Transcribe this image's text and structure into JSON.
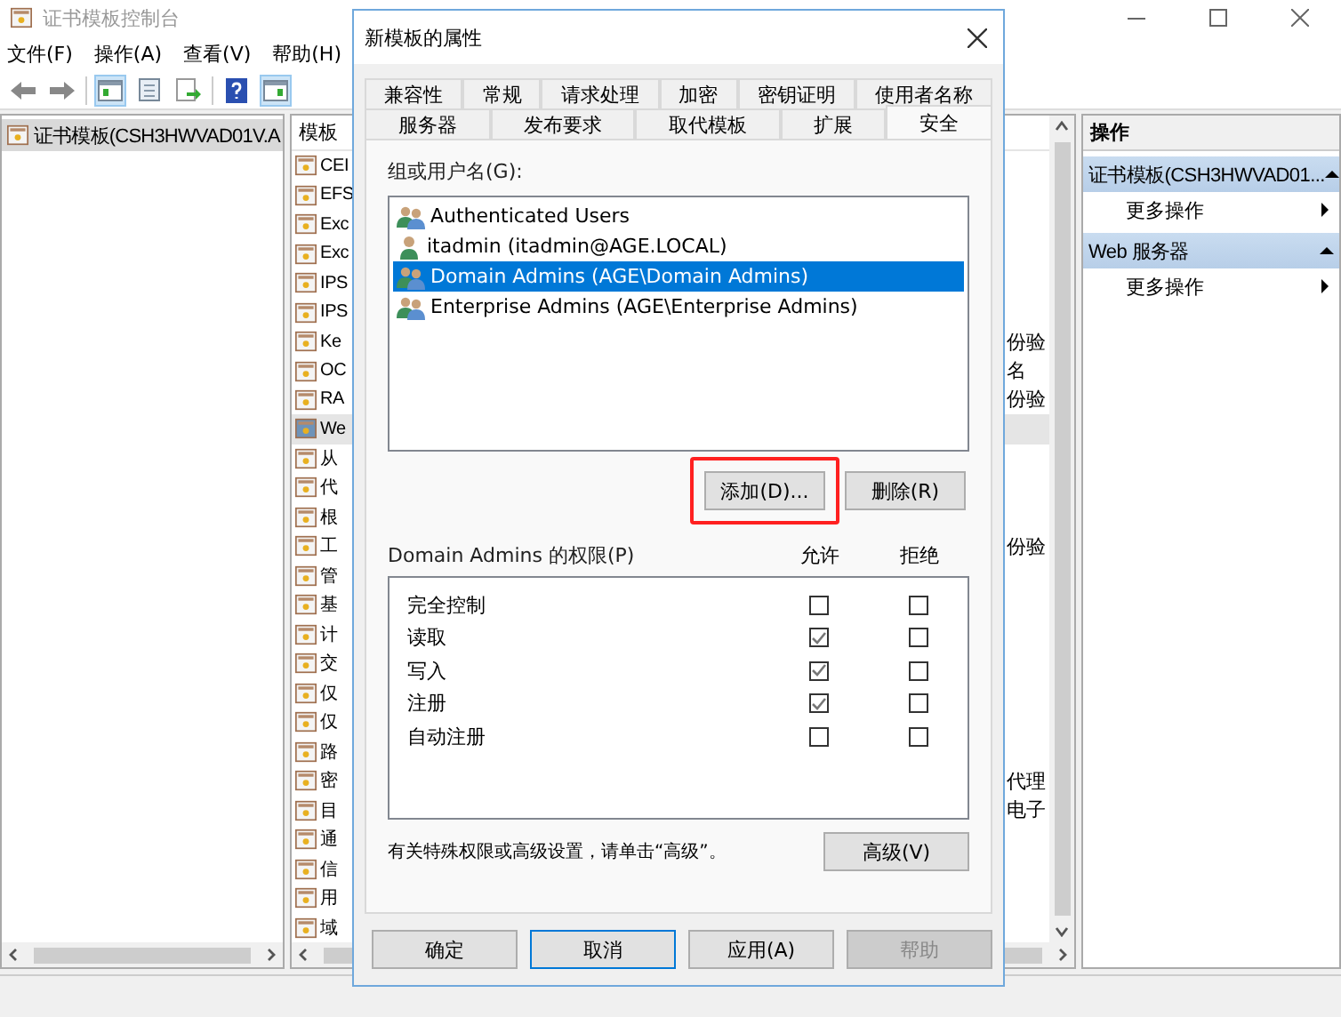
{
  "window": {
    "title": "证书模板控制台"
  },
  "menu": [
    "文件(F)",
    "操作(A)",
    "查看(V)",
    "帮助(H)"
  ],
  "tree": {
    "items": [
      {
        "label": "证书模板(CSH3HWVAD01V.A",
        "selected": true
      }
    ]
  },
  "templates": {
    "header": "模板",
    "rows": [
      {
        "name": "CEI",
        "selected": false
      },
      {
        "name": "EFS",
        "selected": false
      },
      {
        "name": "Exc",
        "selected": false
      },
      {
        "name": "Exc",
        "selected": false
      },
      {
        "name": "IPS",
        "selected": false
      },
      {
        "name": "IPS",
        "selected": false
      },
      {
        "name": "Ke",
        "detail": "份验",
        "selected": false
      },
      {
        "name": "OC",
        "detail": "名",
        "selected": false
      },
      {
        "name": "RA",
        "detail": "份验",
        "selected": false
      },
      {
        "name": "We",
        "selected": true
      },
      {
        "name": "从",
        "selected": false
      },
      {
        "name": "代",
        "selected": false
      },
      {
        "name": "根",
        "selected": false
      },
      {
        "name": "工",
        "detail": "份验",
        "selected": false
      },
      {
        "name": "管",
        "selected": false
      },
      {
        "name": "基",
        "selected": false
      },
      {
        "name": "计",
        "selected": false
      },
      {
        "name": "交",
        "selected": false
      },
      {
        "name": "仅",
        "selected": false
      },
      {
        "name": "仅",
        "selected": false
      },
      {
        "name": "路",
        "selected": false
      },
      {
        "name": "密",
        "detail": "代理",
        "selected": false
      },
      {
        "name": "目",
        "detail": "电子",
        "selected": false
      },
      {
        "name": "通",
        "selected": false
      },
      {
        "name": "信",
        "selected": false
      },
      {
        "name": "用",
        "selected": false
      },
      {
        "name": "域",
        "selected": false
      }
    ]
  },
  "actions": {
    "title": "操作",
    "sections": [
      {
        "title": "证书模板(CSH3HWVAD01...",
        "items": [
          "更多操作"
        ]
      },
      {
        "title": "Web 服务器",
        "items": [
          "更多操作"
        ]
      }
    ]
  },
  "dialog": {
    "title": "新模板的属性",
    "tab_rows": [
      [
        {
          "label": "兼容性",
          "selected": false
        },
        {
          "label": "常规",
          "selected": false
        },
        {
          "label": "请求处理",
          "selected": false
        },
        {
          "label": "加密",
          "selected": false
        },
        {
          "label": "密钥证明",
          "selected": false
        },
        {
          "label": "使用者名称",
          "selected": false
        }
      ],
      [
        {
          "label": "服务器",
          "selected": false
        },
        {
          "label": "发布要求",
          "selected": false
        },
        {
          "label": "取代模板",
          "selected": false
        },
        {
          "label": "扩展",
          "selected": false
        },
        {
          "label": "安全",
          "selected": true
        }
      ]
    ],
    "groups_label": "组或用户名(G):",
    "principals": [
      {
        "name": "Authenticated Users",
        "kind": "group",
        "selected": false
      },
      {
        "name": "itadmin (itadmin@AGE.LOCAL)",
        "kind": "user",
        "selected": false
      },
      {
        "name": "Domain Admins (AGE\\Domain Admins)",
        "kind": "group",
        "selected": true
      },
      {
        "name": "Enterprise Admins (AGE\\Enterprise Admins)",
        "kind": "group",
        "selected": false
      }
    ],
    "principal_buttons": [
      {
        "label": "添加(D)...",
        "highlighted": true
      },
      {
        "label": "删除(R)",
        "highlighted": false
      }
    ],
    "permissions": {
      "label": "Domain Admins 的权限(P)",
      "columns": [
        "允许",
        "拒绝"
      ],
      "rows": [
        {
          "name": "完全控制",
          "allow": false,
          "deny": false
        },
        {
          "name": "读取",
          "allow": true,
          "deny": false
        },
        {
          "name": "写入",
          "allow": true,
          "deny": false
        },
        {
          "name": "注册",
          "allow": true,
          "deny": false
        },
        {
          "name": "自动注册",
          "allow": false,
          "deny": false
        }
      ]
    },
    "advanced_note": "有关特殊权限或高级设置，请单击“高级”。",
    "advanced_button": "高级(V)",
    "buttons": [
      {
        "label": "确定",
        "focused": false,
        "disabled": false
      },
      {
        "label": "取消",
        "focused": true,
        "disabled": false
      },
      {
        "label": "应用(A)",
        "focused": false,
        "disabled": false
      },
      {
        "label": "帮助",
        "focused": false,
        "disabled": true
      }
    ]
  }
}
